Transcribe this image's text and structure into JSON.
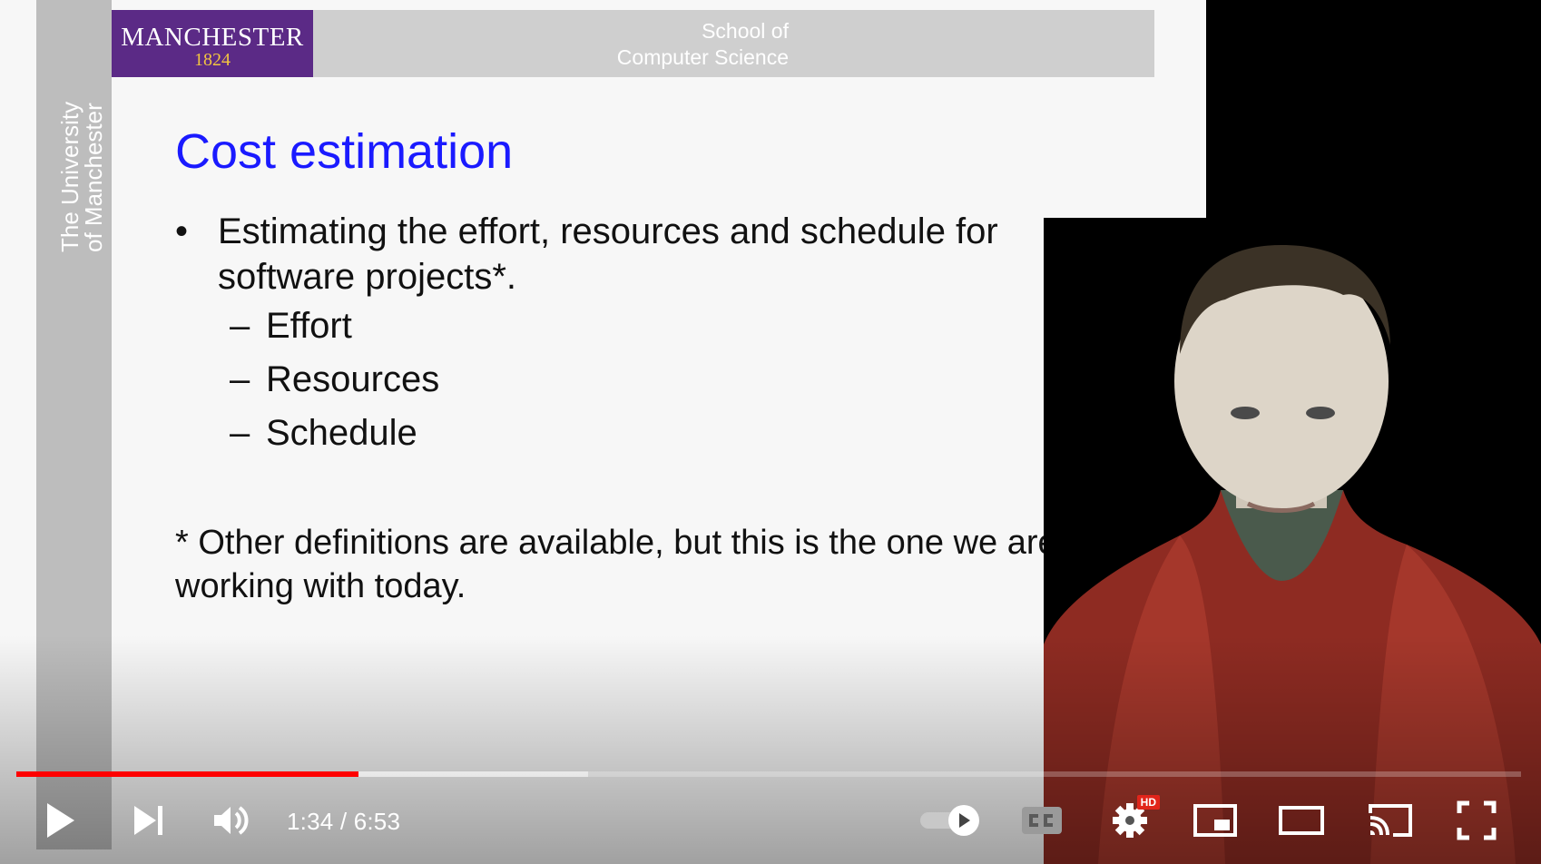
{
  "slide": {
    "logo_name": "MANCHESTER",
    "logo_year": "1824",
    "school_line1": "School of",
    "school_line2": "Computer Science",
    "vertical_line1": "The University",
    "vertical_line2": "of Manchester",
    "title": "Cost estimation",
    "bullet_symbol": "•",
    "bullet_text": "Estimating the effort, resources and schedule for software projects*.",
    "sub_dash": "–",
    "sub_items": [
      "Effort",
      "Resources",
      "Schedule"
    ],
    "footnote": "* Other definitions are available, but this is the one we are working with today."
  },
  "player": {
    "current_time": "1:34",
    "separator": "/",
    "duration": "6:53",
    "time_display": "1:34 / 6:53",
    "played_fraction": 0.2275,
    "buffered_fraction": 0.38,
    "hd_badge": "HD",
    "buttons": {
      "play": "play-icon",
      "next": "next-icon",
      "volume": "volume-icon",
      "autoplay": "autoplay-toggle-icon",
      "captions": "cc-icon",
      "settings": "gear-icon",
      "miniplayer": "miniplayer-icon",
      "theater": "theater-icon",
      "cast": "cast-icon",
      "fullscreen": "fullscreen-icon"
    }
  },
  "colors": {
    "progress_played": "#ff0000",
    "slide_title": "#1a1aff",
    "logo_bg": "#5b2a86",
    "logo_year": "#f3c540",
    "hd_badge": "#e1251b"
  }
}
